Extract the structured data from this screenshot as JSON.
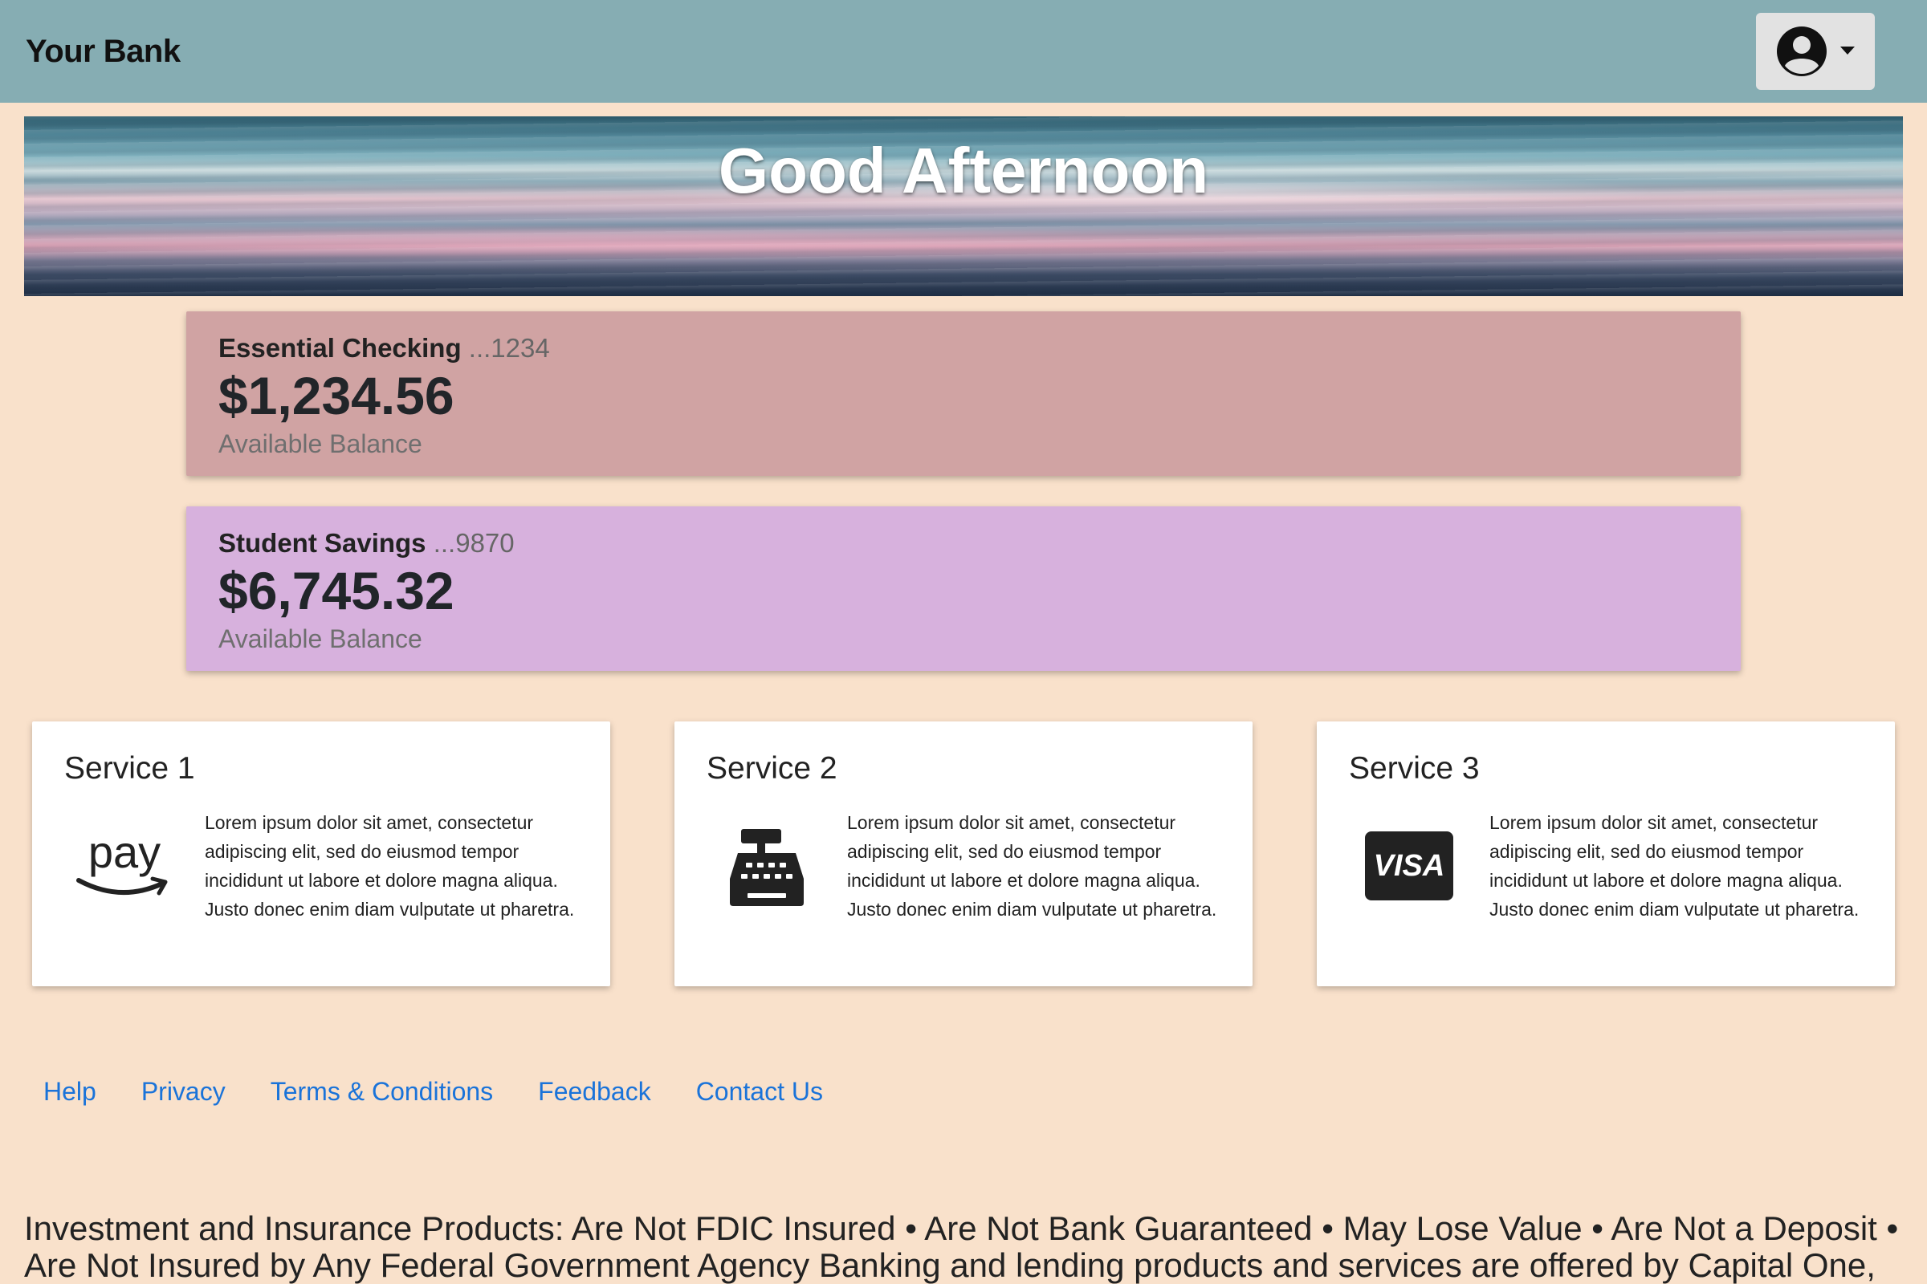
{
  "header": {
    "brand": "Your Bank",
    "user_menu_icon": "account-circle-icon",
    "caret_icon": "caret-down-icon",
    "colors": {
      "bar": "#86adb3",
      "button": "#e2e2e2"
    }
  },
  "hero": {
    "greeting": "Good Afternoon"
  },
  "accounts": [
    {
      "name": "Essential Checking",
      "number": "...1234",
      "balance": "$1,234.56",
      "balance_label": "Available Balance",
      "color": "#d0a3a3"
    },
    {
      "name": "Student Savings",
      "number": "...9870",
      "balance": "$6,745.32",
      "balance_label": "Available Balance",
      "color": "#d7b1dd"
    }
  ],
  "services": [
    {
      "title": "Service 1",
      "icon": "amazon-pay-icon",
      "icon_text": "pay",
      "text": "Lorem ipsum dolor sit amet, consectetur adipiscing elit, sed do eiusmod tempor incididunt ut labore et dolore magna aliqua. Justo donec enim diam vulputate ut pharetra."
    },
    {
      "title": "Service 2",
      "icon": "cash-register-icon",
      "text": "Lorem ipsum dolor sit amet, consectetur adipiscing elit, sed do eiusmod tempor incididunt ut labore et dolore magna aliqua. Justo donec enim diam vulputate ut pharetra."
    },
    {
      "title": "Service 3",
      "icon": "visa-card-icon",
      "icon_text": "VISA",
      "text": "Lorem ipsum dolor sit amet, consectetur adipiscing elit, sed do eiusmod tempor incididunt ut labore et dolore magna aliqua. Justo donec enim diam vulputate ut pharetra."
    }
  ],
  "footer": {
    "links": [
      "Help",
      "Privacy",
      "Terms & Conditions",
      "Feedback",
      "Contact Us"
    ],
    "link_color": "#1a73d9"
  },
  "disclosure": {
    "text": "Investment and Insurance Products: Are Not FDIC Insured • Are Not Bank Guaranteed • May Lose Value • Are Not a Deposit • Are Not Insured by Any Federal Government Agency Banking and lending products and services are offered by Capital One,"
  },
  "page": {
    "background": "#f9e1cb"
  }
}
